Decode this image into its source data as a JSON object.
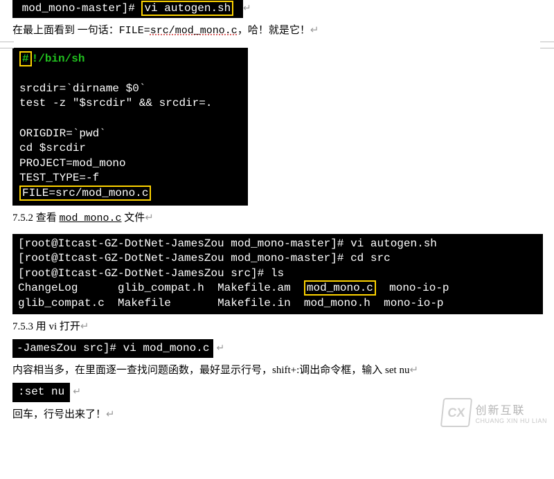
{
  "top_terminal": {
    "prompt_prefix": " mod_mono-master]# ",
    "cmd": "vi autogen.sh"
  },
  "para1": {
    "prefix": "在最上面看到  一句话：",
    "file_eq": "FILE=",
    "file_val": "src/mod_mono.c",
    "suffix": "，哈！就是它！"
  },
  "script_block": {
    "l1a": "#",
    "l1b": "!/bin/sh",
    "l2": "",
    "l3": "srcdir=`dirname $0`",
    "l4": "test -z \"$srcdir\" && srcdir=.",
    "l5": "",
    "l6": "ORIGDIR=`pwd`",
    "l7": "cd $srcdir",
    "l8": "PROJECT=mod_mono",
    "l9": "TEST_TYPE=-f",
    "l10": "FILE=src/mod_mono.c"
  },
  "heading2": {
    "num": "7.5.2 查看 ",
    "file": "mod_mono.c",
    "tail": " 文件"
  },
  "ls_block": {
    "l1_pre": "[root@Itcast-GZ-DotNet-JamesZou mod_mono-master]# vi autogen.sh",
    "l2_pre": "[root@Itcast-GZ-DotNet-JamesZou mod_mono-master]# cd src",
    "l3_pre": "[root@Itcast-GZ-DotNet-JamesZou src]# ls",
    "r1_c1": "ChangeLog",
    "r1_c2": "glib_compat.h",
    "r1_c3": "Makefile.am",
    "r1_c4": "mod_mono.c",
    "r1_c5": "mono-io-p",
    "r2_c1": "glib_compat.c",
    "r2_c2": "Makefile",
    "r2_c3": "Makefile.in",
    "r2_c4": "mod_mono.h",
    "r2_c5": "mono-io-p"
  },
  "heading3": "7.5.3 用 vi 打开",
  "vi_open": {
    "prompt": "-JamesZou src]# vi mod_mono.c"
  },
  "para2": "内容相当多，在里面逐一查找问题函数，最好显示行号，shift+:调出命令框，输入 set nu",
  "setnu": ":set nu",
  "para3": "回车，行号出来了！",
  "watermark": {
    "logo": "CX",
    "cn": "创新互联",
    "en": "CHUANG XIN HU LIAN"
  }
}
